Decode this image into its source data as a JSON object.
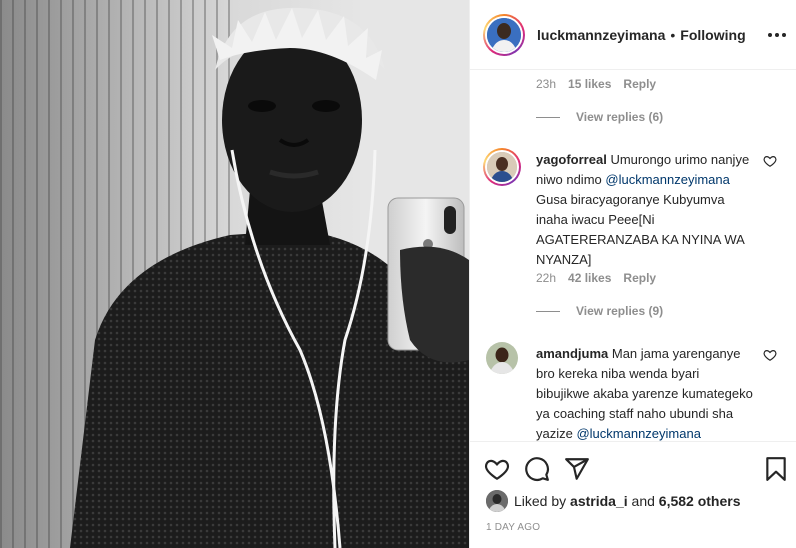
{
  "header": {
    "username": "luckmannzeyimana",
    "separator": "•",
    "follow_status": "Following",
    "more_icon": "more-horizontal-icon"
  },
  "comments": [
    {
      "meta": {
        "time": "23h",
        "likes": "15 likes",
        "reply": "Reply"
      },
      "view_replies": "View replies (6)"
    },
    {
      "username": "yagoforreal",
      "text_before": "Umurongo urimo nanjye niwo ndimo ",
      "mention": "@luckmannzeyimana",
      "text_after": " Gusa biracyagoranye Kubyumva inaha iwacu Peee[Ni AGATERERANZABA KA NYINA WA NYANZA]",
      "meta": {
        "time": "22h",
        "likes": "42 likes",
        "reply": "Reply"
      },
      "view_replies": "View replies (9)"
    },
    {
      "username": "amandjuma",
      "text_before": "Man jama yarenganye bro kereka niba wenda byari bibujikwe akaba yarenze kumategeko ya coaching staff naho ubundi sha yazize ",
      "mention": "@luckmannzeyimana",
      "text_after": ""
    }
  ],
  "actions": {
    "like_icon": "heart-icon",
    "comment_icon": "comment-icon",
    "share_icon": "paper-plane-icon",
    "save_icon": "bookmark-icon"
  },
  "likes": {
    "prefix": "Liked by ",
    "user": "astrida_i",
    "middle": " and ",
    "count": "6,582 others"
  },
  "posted": "1 DAY AGO"
}
